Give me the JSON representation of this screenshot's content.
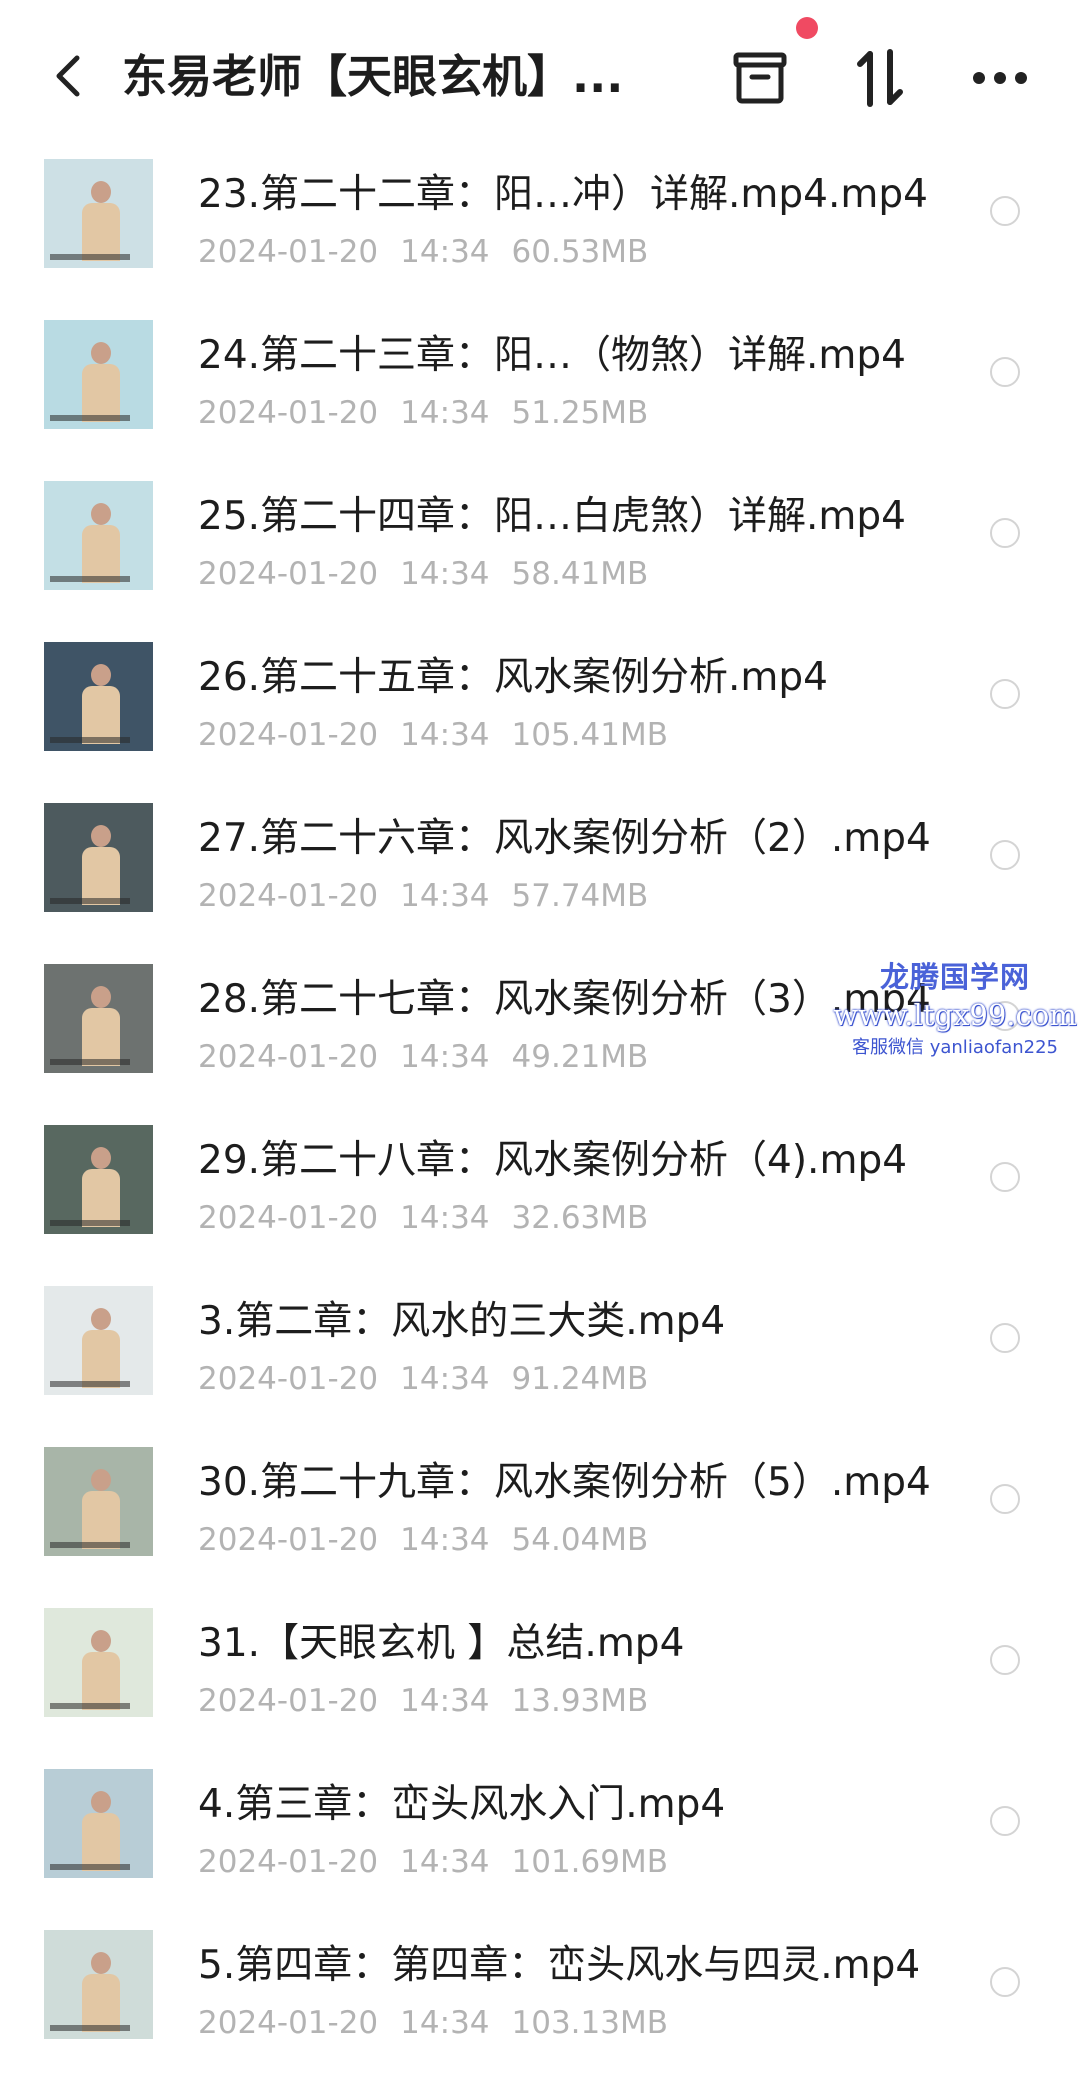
{
  "header": {
    "title": "东易老师【天眼玄机】...",
    "icons": [
      "back-arrow-icon",
      "box-icon",
      "sort-icon",
      "more-icon"
    ],
    "notification_dot_color": "#f04a62"
  },
  "files": [
    {
      "name": "23.第二十二章：阳…冲）详解.mp4.mp4",
      "date": "2024-01-20",
      "time": "14:34",
      "size": "60.53MB",
      "thumb_bg": "#cde0e5"
    },
    {
      "name": "24.第二十三章：阳…（物煞）详解.mp4",
      "date": "2024-01-20",
      "time": "14:34",
      "size": "51.25MB",
      "thumb_bg": "#b9dbe3"
    },
    {
      "name": "25.第二十四章：阳…白虎煞）详解.mp4",
      "date": "2024-01-20",
      "time": "14:34",
      "size": "58.41MB",
      "thumb_bg": "#c3dfe5"
    },
    {
      "name": "26.第二十五章：风水案例分析.mp4",
      "date": "2024-01-20",
      "time": "14:34",
      "size": "105.41MB",
      "thumb_bg": "#3f5466"
    },
    {
      "name": "27.第二十六章：风水案例分析（2）.mp4",
      "date": "2024-01-20",
      "time": "14:34",
      "size": "57.74MB",
      "thumb_bg": "#4d5a5e"
    },
    {
      "name": "28.第二十七章：风水案例分析（3）.mp4",
      "date": "2024-01-20",
      "time": "14:34",
      "size": "49.21MB",
      "thumb_bg": "#6d7270"
    },
    {
      "name": "29.第二十八章：风水案例分析（4).mp4",
      "date": "2024-01-20",
      "time": "14:34",
      "size": "32.63MB",
      "thumb_bg": "#586860"
    },
    {
      "name": "3.第二章：风水的三大类.mp4",
      "date": "2024-01-20",
      "time": "14:34",
      "size": "91.24MB",
      "thumb_bg": "#e4e9ea"
    },
    {
      "name": "30.第二十九章：风水案例分析（5）.mp4",
      "date": "2024-01-20",
      "time": "14:34",
      "size": "54.04MB",
      "thumb_bg": "#a8b5a8"
    },
    {
      "name": "31.【天眼玄机 】总结.mp4",
      "date": "2024-01-20",
      "time": "14:34",
      "size": "13.93MB",
      "thumb_bg": "#dfe8dc"
    },
    {
      "name": "4.第三章：峦头风水入门.mp4",
      "date": "2024-01-20",
      "time": "14:34",
      "size": "101.69MB",
      "thumb_bg": "#b8cdd6"
    },
    {
      "name": "5.第四章：第四章：峦头风水与四灵.mp4",
      "date": "2024-01-20",
      "time": "14:34",
      "size": "103.13MB",
      "thumb_bg": "#cfdcd9"
    }
  ],
  "watermark": {
    "line1": "龙腾国学网",
    "line2": "www.ltgx99.com",
    "line3": "客服微信 yanliaofan225"
  }
}
